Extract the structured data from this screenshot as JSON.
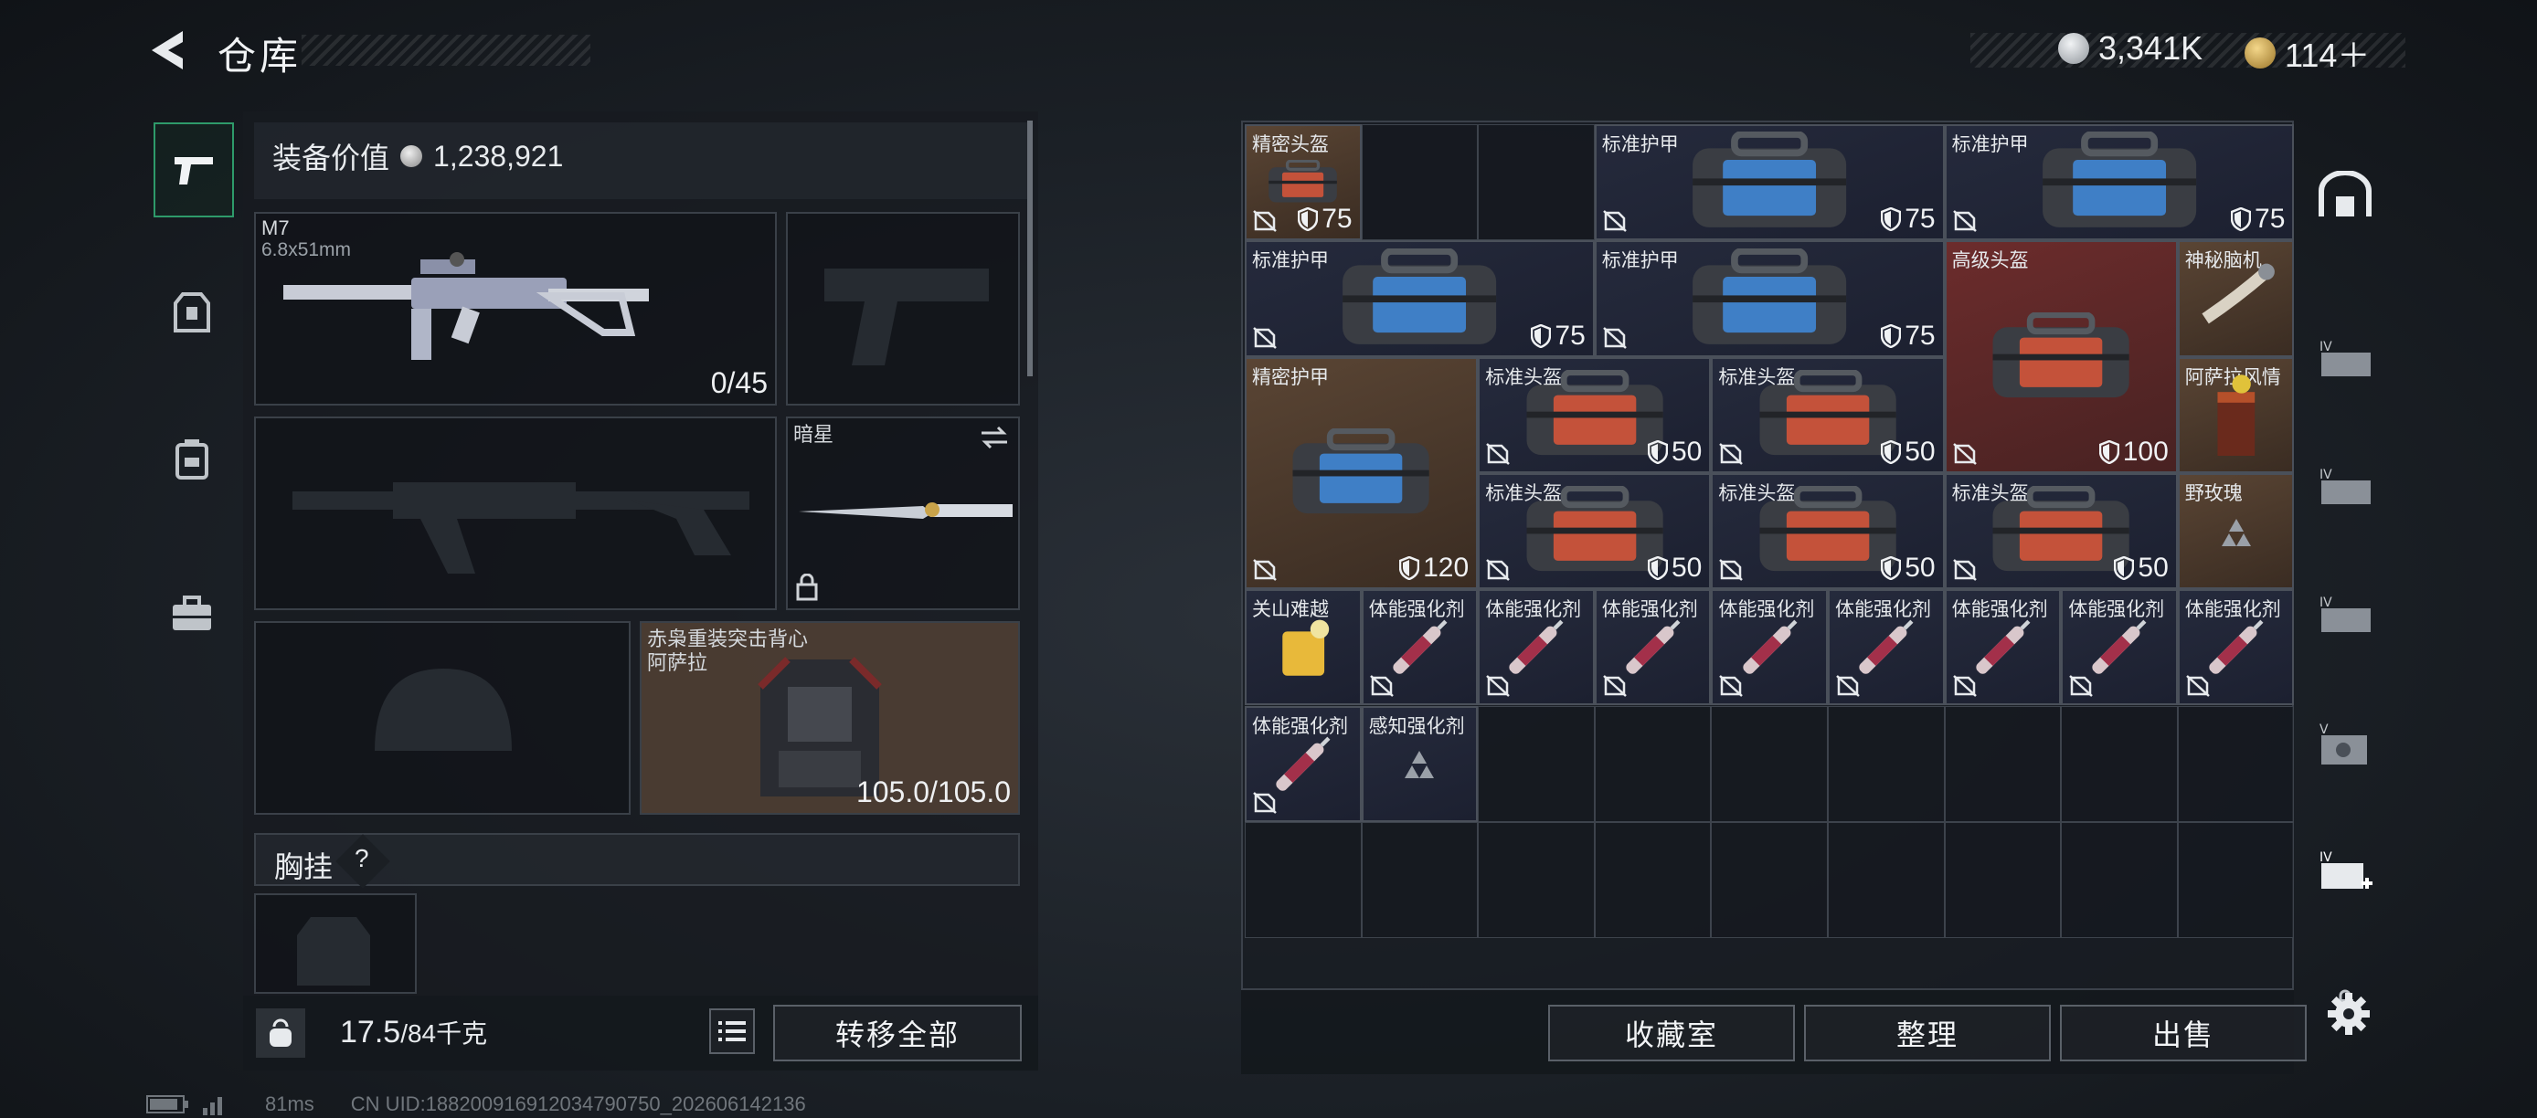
{
  "header": {
    "title": "仓库",
    "currency1": "3,341K",
    "currency2": "114＋",
    "colors": {
      "silver": "#cfd3d8",
      "gold": "#d2a64a"
    }
  },
  "equipment": {
    "value_label": "装备价值",
    "value": "1,238,921",
    "primary": {
      "name": "M7",
      "caliber": "6.8x51mm",
      "ammo": "0/45"
    },
    "melee": {
      "name": "暗星"
    },
    "armor": {
      "name": "赤枭重装突击背心",
      "sub": "阿萨拉",
      "durability": "105.0/105.0"
    },
    "rig": {
      "label": "胸挂",
      "help": "?"
    },
    "weight": {
      "current": "17.5",
      "max": "/84千克"
    },
    "transfer_all": "转移全部"
  },
  "inventory": {
    "items": [
      {
        "name": "精密头盔",
        "dur": "75",
        "bg": "brown",
        "icon": "helmet-case"
      },
      {
        "name": "标准护甲",
        "dur": "75",
        "bg": "navy",
        "icon": "armor-case"
      },
      {
        "name": "标准护甲",
        "dur": "75",
        "bg": "navy",
        "icon": "armor-case"
      },
      {
        "name": "标准护甲",
        "dur": "75",
        "bg": "navy",
        "icon": "armor-case"
      },
      {
        "name": "标准护甲",
        "dur": "75",
        "bg": "navy",
        "icon": "armor-case"
      },
      {
        "name": "高级头盔",
        "dur": "100",
        "bg": "red",
        "icon": "helmet-case"
      },
      {
        "name": "神秘脑机",
        "dur": "",
        "bg": "brown",
        "icon": "brain-chip"
      },
      {
        "name": "精密护甲",
        "dur": "120",
        "bg": "brown",
        "icon": "armor-case"
      },
      {
        "name": "标准头盔",
        "dur": "50",
        "bg": "navy",
        "icon": "helmet-case"
      },
      {
        "name": "标准头盔",
        "dur": "50",
        "bg": "navy",
        "icon": "helmet-case"
      },
      {
        "name": "阿萨拉风情",
        "dur": "",
        "bg": "brown",
        "icon": "drink"
      },
      {
        "name": "标准头盔",
        "dur": "50",
        "bg": "navy",
        "icon": "helmet-case"
      },
      {
        "name": "标准头盔",
        "dur": "50",
        "bg": "navy",
        "icon": "helmet-case"
      },
      {
        "name": "标准头盔",
        "dur": "50",
        "bg": "navy",
        "icon": "helmet-case"
      },
      {
        "name": "野玫瑰",
        "dur": "",
        "bg": "brown",
        "icon": "triangle-mark"
      },
      {
        "name": "关山难越",
        "dur": "",
        "bg": "navy",
        "icon": "cocktail"
      },
      {
        "name": "体能强化剂",
        "dur": "",
        "bg": "navy",
        "icon": "syringe"
      },
      {
        "name": "体能强化剂",
        "dur": "",
        "bg": "navy",
        "icon": "syringe"
      },
      {
        "name": "体能强化剂",
        "dur": "",
        "bg": "navy",
        "icon": "syringe"
      },
      {
        "name": "体能强化剂",
        "dur": "",
        "bg": "navy",
        "icon": "syringe"
      },
      {
        "name": "体能强化剂",
        "dur": "",
        "bg": "navy",
        "icon": "syringe"
      },
      {
        "name": "体能强化剂",
        "dur": "",
        "bg": "navy",
        "icon": "syringe"
      },
      {
        "name": "体能强化剂",
        "dur": "",
        "bg": "navy",
        "icon": "syringe"
      },
      {
        "name": "体能强化剂",
        "dur": "",
        "bg": "navy",
        "icon": "syringe"
      },
      {
        "name": "体能强化剂",
        "dur": "",
        "bg": "navy",
        "icon": "syringe"
      },
      {
        "name": "感知强化剂",
        "dur": "",
        "bg": "navy",
        "icon": "triangle-mark"
      }
    ]
  },
  "actions": {
    "collection": "收藏室",
    "sort": "整理",
    "sell": "出售"
  },
  "footer": {
    "ping": "81ms",
    "uid": "CN UID:188200916912034790750_202606142136"
  }
}
